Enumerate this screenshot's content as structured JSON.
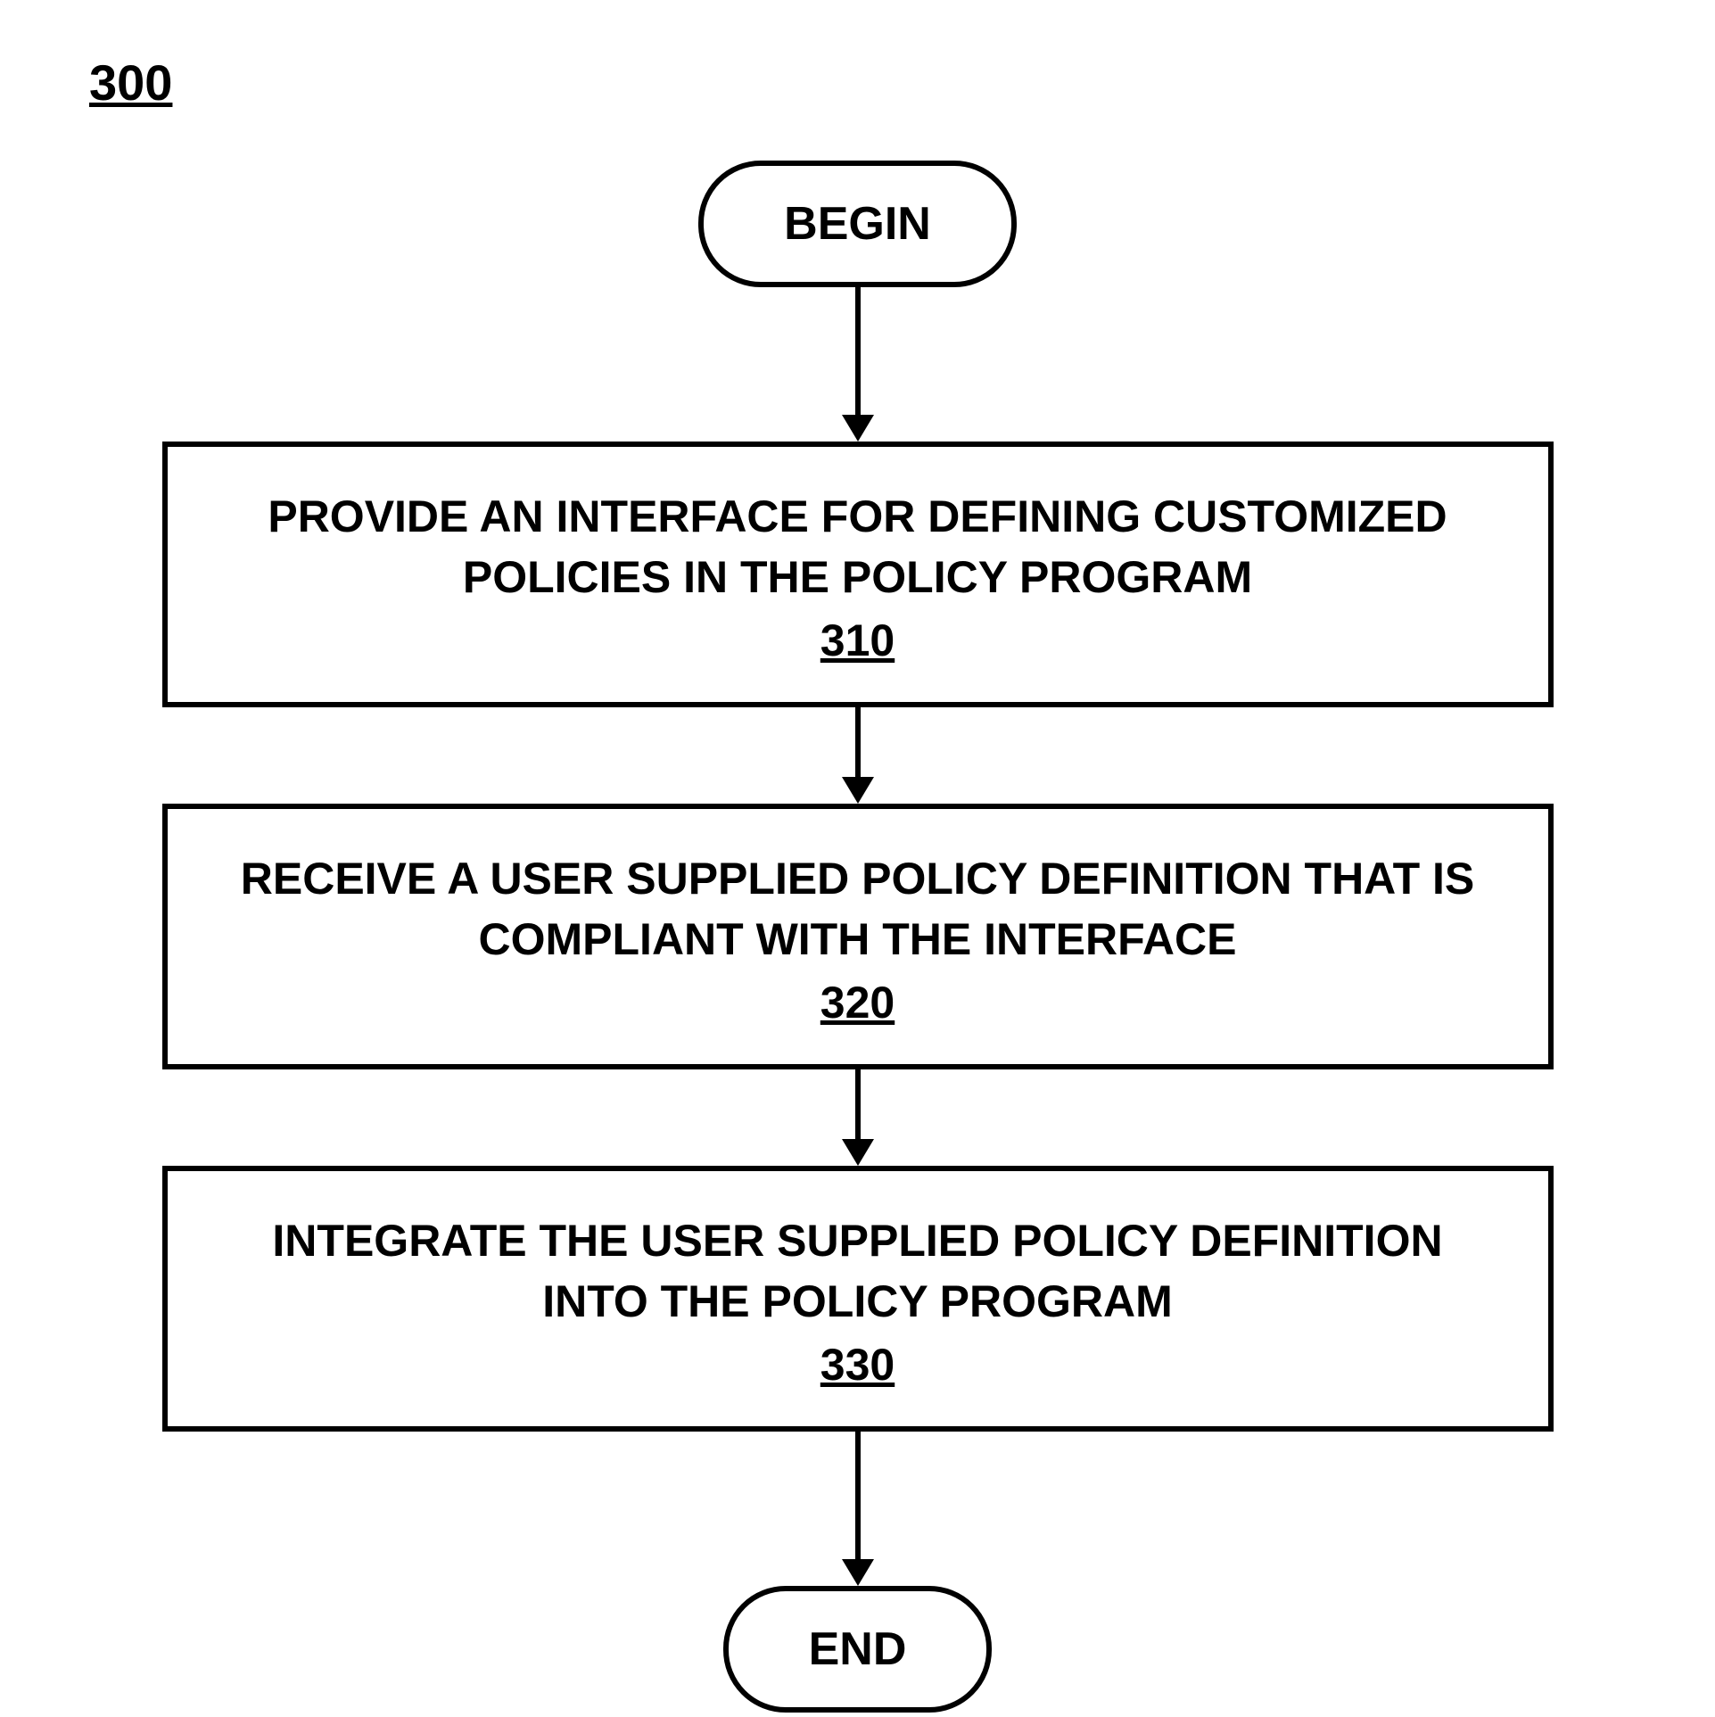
{
  "figure_number": "300",
  "nodes": {
    "begin": "BEGIN",
    "end": "END",
    "step1": {
      "text": "PROVIDE AN INTERFACE FOR DEFINING CUSTOMIZED POLICIES IN THE POLICY PROGRAM",
      "number": "310"
    },
    "step2": {
      "text": "RECEIVE A USER SUPPLIED POLICY DEFINITION THAT IS COMPLIANT WITH THE INTERFACE",
      "number": "320"
    },
    "step3": {
      "text": "INTEGRATE THE USER SUPPLIED POLICY DEFINITION INTO THE POLICY PROGRAM",
      "number": "330"
    }
  }
}
